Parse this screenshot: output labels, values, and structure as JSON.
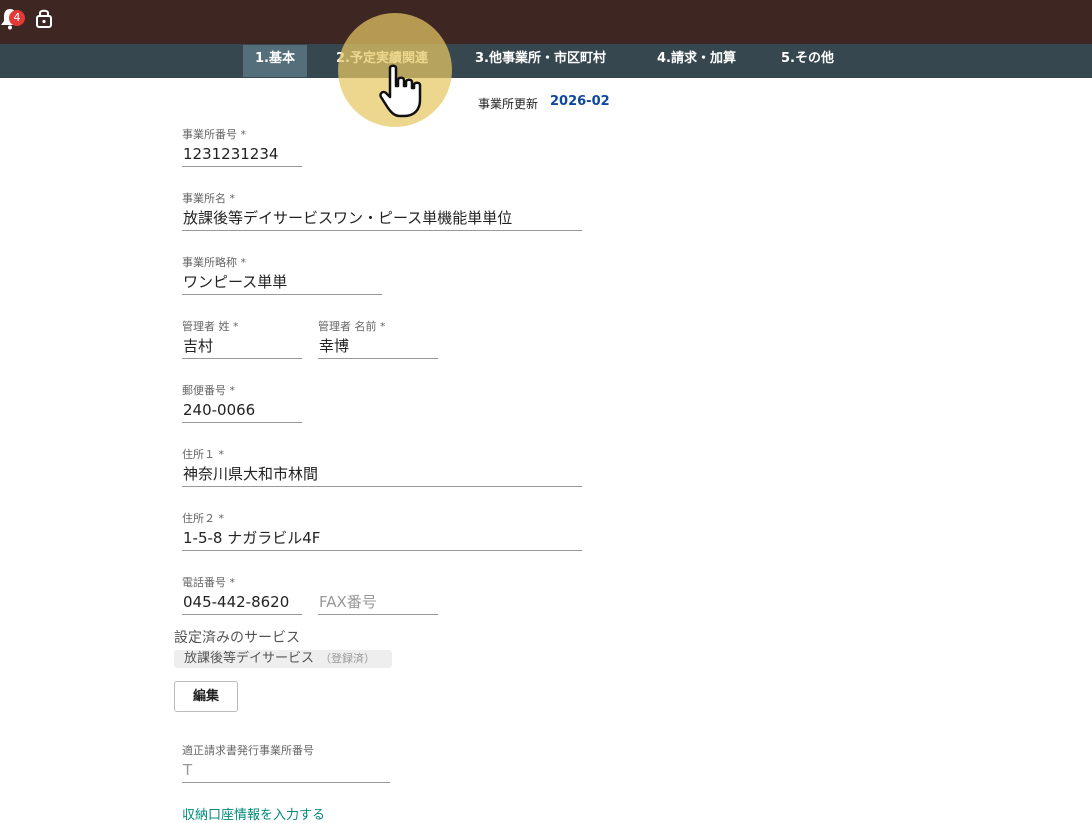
{
  "header": {
    "notification_count": "4",
    "notification_icon": "bell-icon",
    "lock_icon": "unlock-icon"
  },
  "tabs": [
    {
      "label": "1.基本",
      "active": true
    },
    {
      "label": "2.予定実績関連",
      "active": false
    },
    {
      "label": "3.他事業所・市区町村",
      "active": false
    },
    {
      "label": "4.請求・加算",
      "active": false
    },
    {
      "label": "5.その他",
      "active": false
    }
  ],
  "update": {
    "label": "事業所更新",
    "value": "2026-02"
  },
  "form": {
    "office_number": {
      "label": "事業所番号 *",
      "value": "1231231234"
    },
    "office_name": {
      "label": "事業所名 *",
      "value": "放課後等デイサービスワン・ピース単機能単単位"
    },
    "office_short": {
      "label": "事業所略称 *",
      "value": "ワンピース単単"
    },
    "manager_last": {
      "label": "管理者 姓 *",
      "value": "吉村"
    },
    "manager_first": {
      "label": "管理者 名前 *",
      "value": "幸博"
    },
    "postal": {
      "label": "郵便番号 *",
      "value": "240-0066"
    },
    "address1": {
      "label": "住所１ *",
      "value": "神奈川県大和市林間"
    },
    "address2": {
      "label": "住所２ *",
      "value": "1-5-8 ナガラビル4F"
    },
    "phone": {
      "label": "電話番号 *",
      "value": "045-442-8620"
    },
    "fax": {
      "placeholder": "FAX番号"
    },
    "invoice": {
      "label": "適正請求書発行事業所番号",
      "placeholder": "T"
    }
  },
  "services": {
    "title": "設定済みのサービス",
    "item": "放課後等デイサービス",
    "item_status": "（登録済）",
    "edit_label": "編集"
  },
  "bank_link": "収納口座情報を入力する",
  "colors": {
    "topbar": "#3e2723",
    "tabbar": "#37474f",
    "accent": "#0d47a1",
    "link": "#00897b"
  }
}
